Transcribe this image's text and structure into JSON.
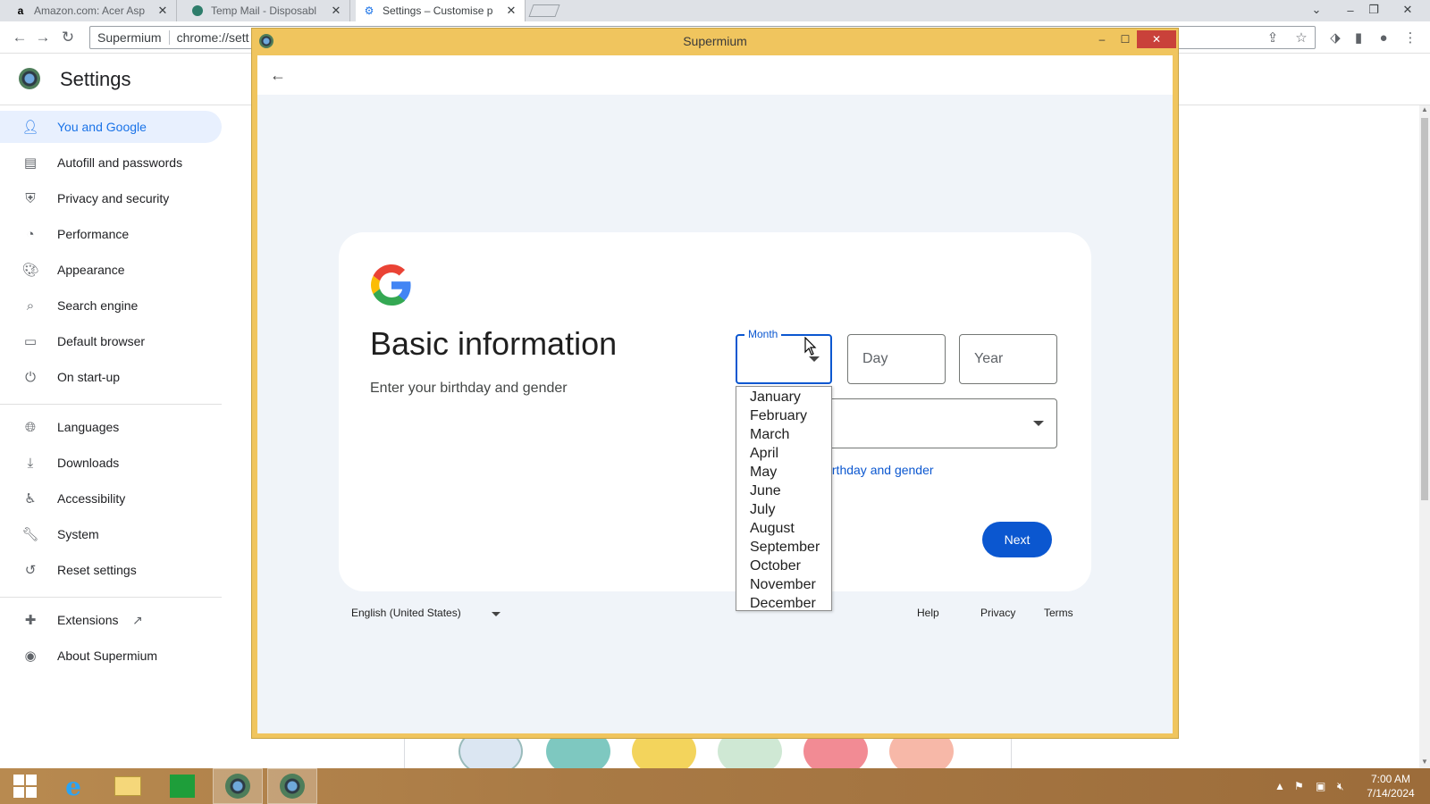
{
  "browser": {
    "tabs": [
      {
        "title": "Amazon.com: Acer Asp",
        "favicon": "amazon-icon"
      },
      {
        "title": "Temp Mail - Disposabl",
        "favicon": "tempmail-icon"
      },
      {
        "title": "Settings – Customise p",
        "favicon": "gear-icon",
        "active": true
      }
    ],
    "omnibox": {
      "site": "Supermium",
      "url": "chrome://sett"
    }
  },
  "settings": {
    "title": "Settings",
    "sidebar": [
      {
        "label": "You and Google",
        "icon": "person-icon",
        "active": true
      },
      {
        "label": "Autofill and passwords",
        "icon": "clipboard-icon"
      },
      {
        "label": "Privacy and security",
        "icon": "shield-icon"
      },
      {
        "label": "Performance",
        "icon": "speedometer-icon"
      },
      {
        "label": "Appearance",
        "icon": "palette-icon"
      },
      {
        "label": "Search engine",
        "icon": "search-icon"
      },
      {
        "label": "Default browser",
        "icon": "browser-icon"
      },
      {
        "label": "On start-up",
        "icon": "power-icon"
      },
      {
        "label": "Languages",
        "icon": "globe-icon"
      },
      {
        "label": "Downloads",
        "icon": "download-icon"
      },
      {
        "label": "Accessibility",
        "icon": "accessibility-icon"
      },
      {
        "label": "System",
        "icon": "wrench-icon"
      },
      {
        "label": "Reset settings",
        "icon": "reset-icon"
      },
      {
        "label": "Extensions",
        "icon": "puzzle-icon"
      },
      {
        "label": "About Supermium",
        "icon": "supermium-icon"
      }
    ]
  },
  "popup": {
    "window_title": "Supermium",
    "heading": "Basic information",
    "subtitle": "Enter your birthday and gender",
    "month_label": "Month",
    "day_placeholder": "Day",
    "year_placeholder": "Year",
    "why_link": "birthday and gender",
    "next_label": "Next",
    "months": [
      "January",
      "February",
      "March",
      "April",
      "May",
      "June",
      "July",
      "August",
      "September",
      "October",
      "November",
      "December"
    ],
    "footer": {
      "language": "English (United States)",
      "help": "Help",
      "privacy": "Privacy",
      "terms": "Terms"
    }
  },
  "taskbar": {
    "time": "7:00 AM",
    "date": "7/14/2024"
  },
  "colors": {
    "accent": "#0b57d0",
    "popup_frame": "#f0c55e",
    "taskbar": "#a97a45"
  }
}
